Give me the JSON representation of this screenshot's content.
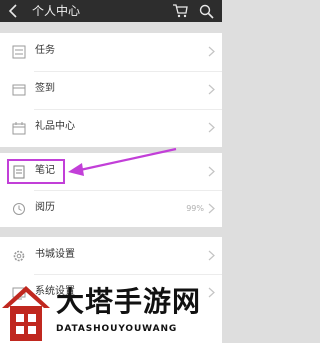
{
  "header": {
    "title": "个人中心",
    "back_icon": "back-arrow-icon",
    "cart_icon": "cart-icon",
    "search_icon": "search-icon"
  },
  "menu_groups": [
    {
      "items": [
        {
          "label": "任务",
          "icon": "task-list-icon"
        },
        {
          "label": "签到",
          "icon": "checkin-card-icon"
        },
        {
          "label": "礼品中心",
          "icon": "gift-calendar-icon"
        }
      ]
    },
    {
      "items": [
        {
          "label": "笔记",
          "icon": "note-icon"
        },
        {
          "label": "阅历",
          "icon": "reading-history-icon",
          "value": "99%"
        }
      ]
    },
    {
      "items": [
        {
          "label": "书城设置",
          "icon": "settings-gear-icon"
        },
        {
          "label": "系统设置",
          "icon": "system-settings-icon"
        }
      ]
    }
  ],
  "annotation": {
    "color": "#c23fd8"
  },
  "watermark": {
    "title": "大塔手游网",
    "subtitle": "DATASHOUYOUWANG"
  }
}
